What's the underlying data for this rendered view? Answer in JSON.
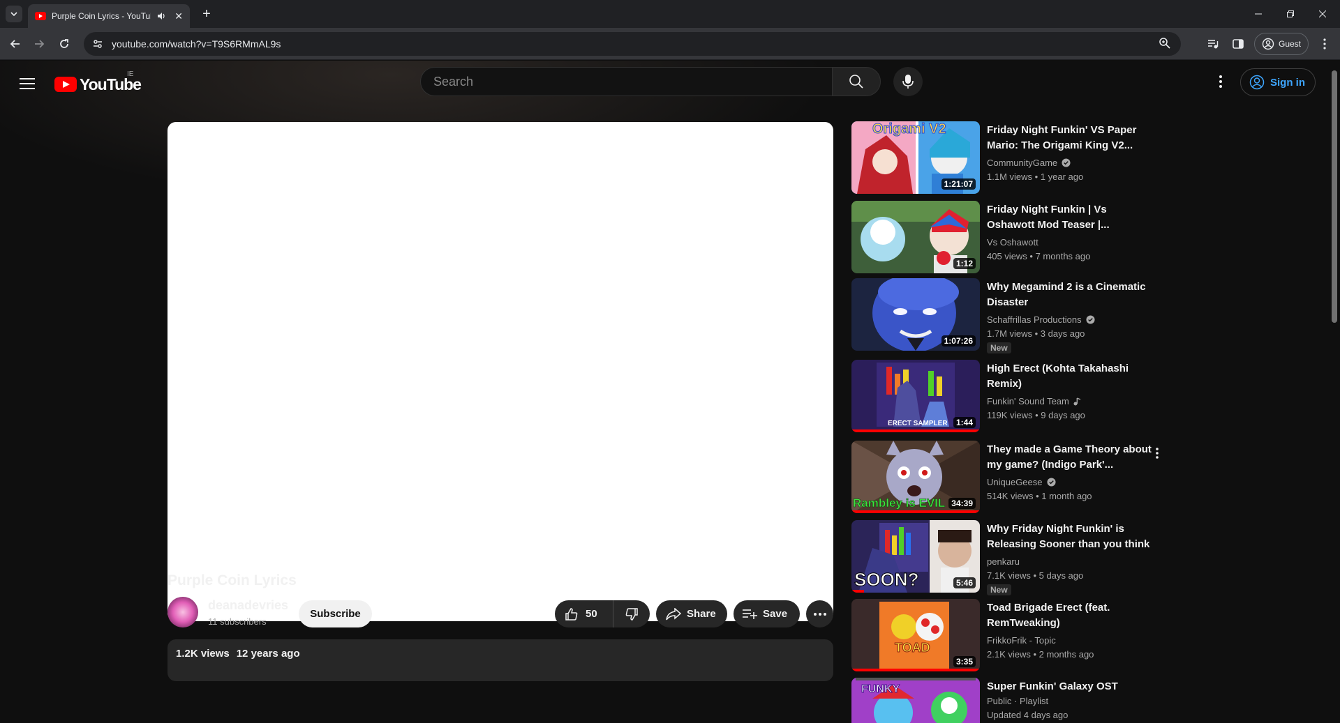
{
  "browser": {
    "tab_title": "Purple Coin Lyrics - YouTube",
    "url": "youtube.com/watch?v=T9S6RMmAL9s",
    "guest_label": "Guest"
  },
  "header": {
    "logo_text": "YouTube",
    "country": "IE",
    "search_placeholder": "Search",
    "signin_label": "Sign in"
  },
  "video": {
    "title": "Purple Coin Lyrics",
    "channel": "deanadevries",
    "subscribers": "11 subscribers",
    "subscribe_label": "Subscribe",
    "likes": "50",
    "share_label": "Share",
    "save_label": "Save",
    "views": "1.2K views",
    "age": "12 years ago"
  },
  "recommendations": [
    {
      "title": "Friday Night Funkin' VS Paper Mario: The Origami King V2...",
      "channel": "CommunityGame",
      "verified": true,
      "music": false,
      "meta": "1.1M views • 1 year ago",
      "duration": "1:21:07",
      "thumb_text": "Origami V2",
      "new": false
    },
    {
      "title": "Friday Night Funkin | Vs Oshawott Mod Teaser |...",
      "channel": "Vs Oshawott",
      "verified": false,
      "music": false,
      "meta": "405 views • 7 months ago",
      "duration": "1:12",
      "thumb_text": "",
      "new": false
    },
    {
      "title": "Why Megamind 2 is a Cinematic Disaster",
      "channel": "Schaffrillas Productions",
      "verified": true,
      "music": false,
      "meta": "1.7M views • 3 days ago",
      "duration": "1:07:26",
      "thumb_text": "",
      "new": true,
      "new_label": "New"
    },
    {
      "title": "High Erect (Kohta Takahashi Remix)",
      "channel": "Funkin' Sound Team",
      "verified": false,
      "music": true,
      "meta": "119K views • 9 days ago",
      "duration": "1:44",
      "thumb_text": "ERECT SAMPLER",
      "new": false
    },
    {
      "title": "They made a Game Theory about my game? (Indigo Park'...",
      "channel": "UniqueGeese",
      "verified": true,
      "music": false,
      "meta": "514K views • 1 month ago",
      "duration": "34:39",
      "thumb_text": "Rambley is EVIL",
      "new": false
    },
    {
      "title": "Why Friday Night Funkin' is Releasing Sooner than you think",
      "channel": "penkaru",
      "verified": false,
      "music": false,
      "meta": "7.1K views • 5 days ago",
      "duration": "5:46",
      "thumb_text": "SOON?",
      "new": true,
      "new_label": "New"
    },
    {
      "title": "Toad Brigade Erect (feat. RemTweaking)",
      "channel": "FrikkoFrik - Topic",
      "verified": false,
      "music": false,
      "meta": "2.1K views • 2 months ago",
      "duration": "3:35",
      "thumb_text": "TOAD",
      "new": false
    },
    {
      "title": "Super Funkin' Galaxy OST",
      "channel": "Public · Playlist",
      "verified": false,
      "music": false,
      "meta": "Updated 4 days ago",
      "duration": "",
      "thumb_text": "FUNKY",
      "new": false
    }
  ],
  "colors": {
    "brand_red": "#ff0000",
    "link_blue": "#3ea6ff",
    "background": "#0f0f0f"
  }
}
